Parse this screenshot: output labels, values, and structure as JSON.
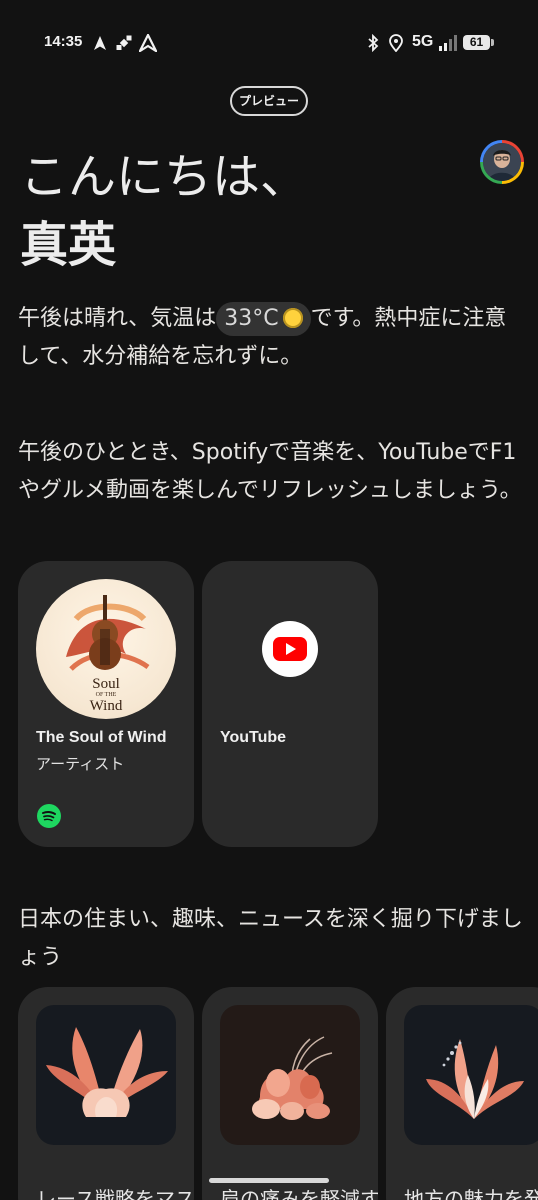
{
  "status_bar": {
    "time": "14:35",
    "network": "5G",
    "battery": "61",
    "icons": [
      "navigation-arrow-icon",
      "satellite-icon",
      "maps-icon",
      "bluetooth-icon",
      "location-icon",
      "signal-icon"
    ]
  },
  "preview_label": "プレビュー",
  "greeting": {
    "hello": "こんにちは、",
    "name": "真英"
  },
  "weather": {
    "before": "午後は晴れ、気温は",
    "temperature": "33°C",
    "after": "です。熱中症に注意して、水分補給を忘れずに。",
    "icon": "sun-icon"
  },
  "section1": {
    "text": "午後のひととき、Spotifyで音楽を、YouTubeでF1やグルメ動画を楽しんでリフレッシュしましょう。",
    "cards": [
      {
        "title": "The Soul of Wind",
        "subtitle": "アーティスト",
        "cover_text_1": "Soul",
        "cover_text_2": "Wind",
        "cover_small": "OF THE",
        "app_icon": "spotify-icon"
      },
      {
        "title": "YouTube",
        "app_icon": "youtube-icon"
      }
    ]
  },
  "section2": {
    "text": "日本の住まい、趣味、ニュースを深く掘り下げましょう",
    "cards": [
      {
        "title": "レース戦略をマス"
      },
      {
        "title": "肩の痛みを軽減す"
      },
      {
        "title": "地方の魅力を発見"
      }
    ]
  },
  "colors": {
    "background": "#121212",
    "card": "#2a2a2a",
    "spotify": "#1ed760",
    "youtube": "#ff0000",
    "accent_coral": "#e8866b"
  }
}
